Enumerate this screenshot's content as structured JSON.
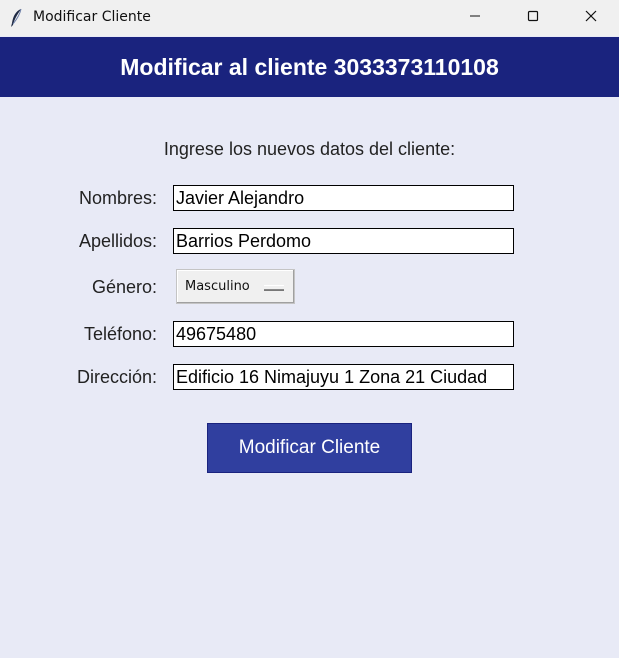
{
  "window": {
    "title": "Modificar Cliente",
    "icon": "feather-icon",
    "controls": [
      "minimize-icon",
      "maximize-icon",
      "close-icon"
    ]
  },
  "header": {
    "title": "Modificar al cliente 3033373110108",
    "background": "#1a237e"
  },
  "form": {
    "subtitle": "Ingrese los nuevos datos del cliente:",
    "nombres_label": "Nombres:",
    "nombres_value": "Javier Alejandro",
    "apellidos_label": "Apellidos:",
    "apellidos_value": "Barrios Perdomo",
    "genero_label": "Género:",
    "genero_value": "Masculino",
    "telefono_label": "Teléfono:",
    "telefono_value": "49675480",
    "direccion_label": "Dirección:",
    "direccion_value": "Edificio 16 Nimajuyu 1 Zona 21 Ciudad",
    "submit_label": "Modificar Cliente",
    "submit_color": "#303f9f",
    "background": "#e8eaf6"
  }
}
